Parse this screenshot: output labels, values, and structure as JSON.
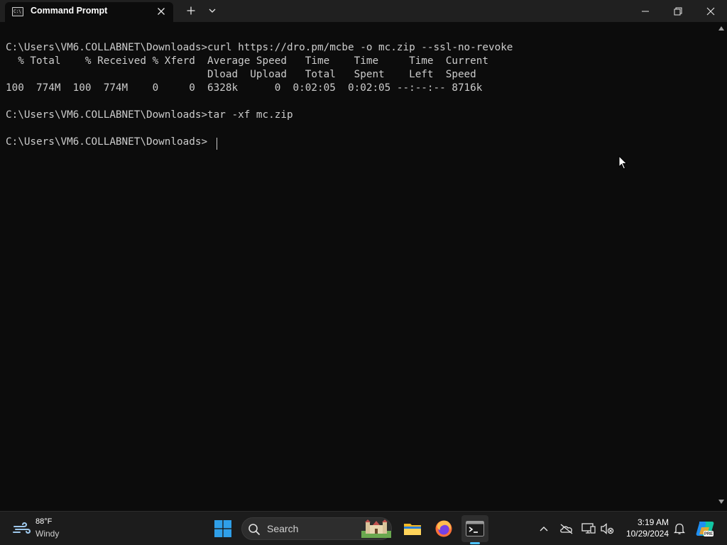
{
  "window": {
    "tab_title": "Command Prompt",
    "tab_icon_text": "C:\\"
  },
  "terminal": {
    "lines": [
      "C:\\Users\\VM6.COLLABNET\\Downloads>curl https://dro.pm/mcbe -o mc.zip --ssl-no-revoke",
      "  % Total    % Received % Xferd  Average Speed   Time    Time     Time  Current",
      "                                 Dload  Upload   Total   Spent    Left  Speed",
      "100  774M  100  774M    0     0  6328k      0  0:02:05  0:02:05 --:--:-- 8716k",
      "",
      "C:\\Users\\VM6.COLLABNET\\Downloads>tar -xf mc.zip",
      "",
      "C:\\Users\\VM6.COLLABNET\\Downloads>"
    ]
  },
  "taskbar": {
    "weather": {
      "temp": "88°F",
      "desc": "Windy",
      "icon": "wind-icon"
    },
    "search": {
      "label": "Search",
      "icon": "search-icon"
    },
    "pinned": [
      {
        "name": "start",
        "icon": "windows-logo-icon"
      },
      {
        "name": "file-explorer",
        "icon": "folder-icon"
      },
      {
        "name": "firefox",
        "icon": "firefox-icon"
      },
      {
        "name": "terminal",
        "icon": "terminal-icon",
        "active": true
      }
    ],
    "clock": {
      "time": "3:19 AM",
      "date": "10/29/2024"
    }
  },
  "colors": {
    "terminal_bg": "#0c0c0c",
    "terminal_fg": "#cccccc",
    "titlebar_bg": "#202020",
    "taskbar_bg": "#1c1c1c",
    "accent": "#4cc2ff"
  }
}
